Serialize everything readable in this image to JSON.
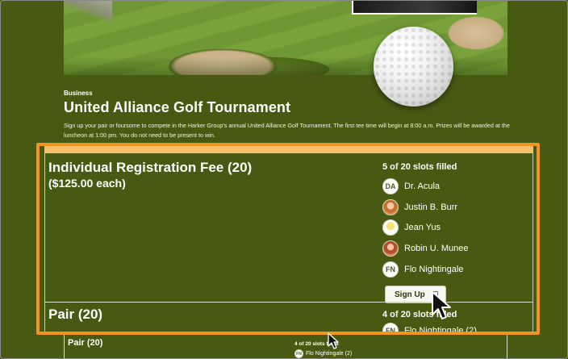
{
  "event": {
    "category": "Business",
    "title": "United Alliance Golf Tournament",
    "description": "Sign up your pair or foursome to compete in the Harker Group's annual United Alliance Golf Tournament. The first tee time will begin at 8:00 a.m. Prizes will be awarded at the luncheon at 1:00 pm. You do not need to be present to win."
  },
  "items": [
    {
      "title": "Individual Registration Fee (20)",
      "price": "($125.00 each)",
      "slots": "5 of 20 slots filled",
      "signups": [
        {
          "initials": "DA",
          "name": "Dr. Acula"
        },
        {
          "initials": "",
          "name": "Justin B. Burr"
        },
        {
          "initials": "",
          "name": "Jean Yus"
        },
        {
          "initials": "",
          "name": "Robin U. Munee"
        },
        {
          "initials": "FN",
          "name": "Flo Nightingale"
        }
      ],
      "signup_button": "Sign Up"
    },
    {
      "title": "Pair (20)",
      "slots": "4 of 20 slots filled",
      "signups": [
        {
          "initials": "FN",
          "name": "Flo Nightingale (2)"
        }
      ]
    }
  ],
  "small_pair": {
    "title": "Pair (20)",
    "slots": "4 of 20 slots filled",
    "initials": "FN",
    "name": "Flo Nightingale (2)"
  },
  "colors": {
    "background": "#485a12",
    "highlight": "#f39321",
    "topbar": "#f6c06d"
  }
}
